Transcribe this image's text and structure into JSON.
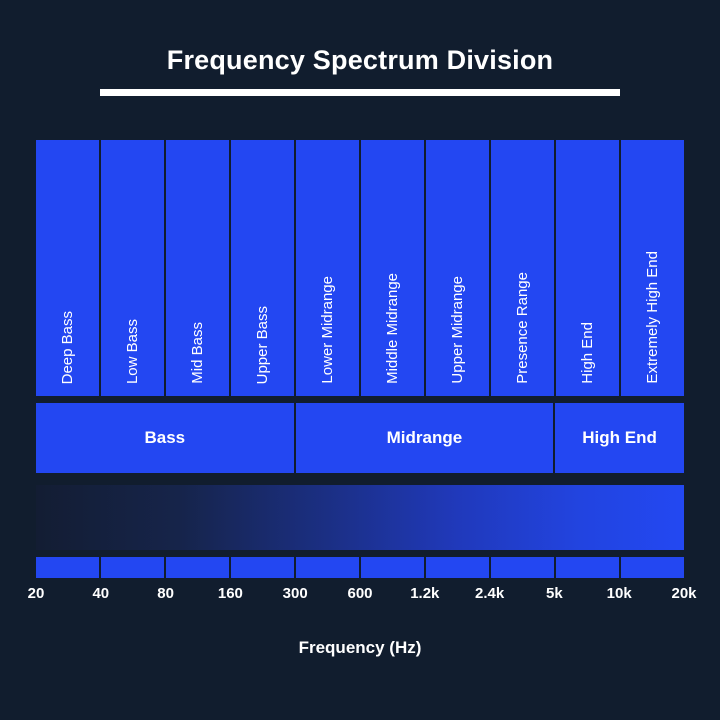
{
  "header": {
    "title": "Frequency Spectrum Division"
  },
  "colors": {
    "background": "#111d2e",
    "band": "#2347f2",
    "text": "#ffffff",
    "gradient_start": "#131d33",
    "gradient_end": "#2348f2"
  },
  "axis": {
    "title": "Frequency (Hz)"
  },
  "chart_data": {
    "type": "bar",
    "title": "Frequency Spectrum Division",
    "xlabel": "Frequency (Hz)",
    "ylabel": "",
    "grid": false,
    "legend": "none",
    "scale": "log",
    "tick_labels": [
      "20",
      "40",
      "80",
      "160",
      "300",
      "600",
      "1.2k",
      "2.4k",
      "5k",
      "10k",
      "20k"
    ],
    "tick_values": [
      20,
      40,
      80,
      160,
      300,
      600,
      1200,
      2400,
      5000,
      10000,
      20000
    ],
    "categories": [
      "Deep Bass",
      "Low Bass",
      "Mid Bass",
      "Upper Bass",
      "Lower Midrange",
      "Middle Midrange",
      "Upper Midrange",
      "Presence Range",
      "High End",
      "Extremely High End"
    ],
    "bands": [
      {
        "label": "Deep Bass",
        "from": "20",
        "to": "40",
        "group": "Bass"
      },
      {
        "label": "Low Bass",
        "from": "40",
        "to": "80",
        "group": "Bass"
      },
      {
        "label": "Mid Bass",
        "from": "80",
        "to": "160",
        "group": "Bass"
      },
      {
        "label": "Upper Bass",
        "from": "160",
        "to": "300",
        "group": "Bass"
      },
      {
        "label": "Lower Midrange",
        "from": "300",
        "to": "600",
        "group": "Midrange"
      },
      {
        "label": "Middle Midrange",
        "from": "600",
        "to": "1.2k",
        "group": "Midrange"
      },
      {
        "label": "Upper Midrange",
        "from": "1.2k",
        "to": "2.4k",
        "group": "Midrange"
      },
      {
        "label": "Presence Range",
        "from": "2.4k",
        "to": "5k",
        "group": "Midrange"
      },
      {
        "label": "High End",
        "from": "5k",
        "to": "10k",
        "group": "High End"
      },
      {
        "label": "Extremely High End",
        "from": "10k",
        "to": "20k",
        "group": "High End"
      }
    ],
    "groups": [
      {
        "label": "Bass",
        "span": 4
      },
      {
        "label": "Midrange",
        "span": 4
      },
      {
        "label": "High End",
        "span": 2
      }
    ],
    "segments_count": 10
  }
}
